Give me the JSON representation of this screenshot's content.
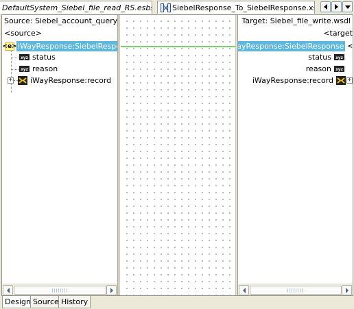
{
  "editor_tabs": [
    {
      "label": "DefaultSystem_Siebel_file_read_RS.esbsvc",
      "active": false
    },
    {
      "label": "SiebelResponse_To_SiebelResponse.xsl",
      "active": true
    }
  ],
  "source_pane": {
    "header": "Source: Siebel_account_query_in",
    "root_label": "<source>",
    "selected_node": "iWayResponse:SiebelResponse",
    "children": [
      {
        "label": "status",
        "icon": "xyz-attribute-icon"
      },
      {
        "label": "reason",
        "icon": "xyz-attribute-icon"
      },
      {
        "label": "iWayResponse:record",
        "icon": "element-icon",
        "expander": "+"
      }
    ]
  },
  "target_pane": {
    "header": "Target: Siebel_file_write.wsdl",
    "root_label": "<target",
    "selected_node": "iWayResponse:SiebelResponse",
    "children": [
      {
        "label": "status",
        "icon": "xyz-attribute-icon"
      },
      {
        "label": "reason",
        "icon": "xyz-attribute-icon"
      },
      {
        "label": "iWayResponse:record",
        "icon": "element-icon",
        "expander": "+"
      }
    ]
  },
  "badges": {
    "attribute_text": "xyz",
    "tag_text": "<e>"
  },
  "mapping_line_color": "#4cc43c",
  "selection_color": "#5eb7dd",
  "bottom_tabs": [
    {
      "label": "Design",
      "active": true
    },
    {
      "label": "Source",
      "active": false
    },
    {
      "label": "History",
      "active": false
    }
  ]
}
